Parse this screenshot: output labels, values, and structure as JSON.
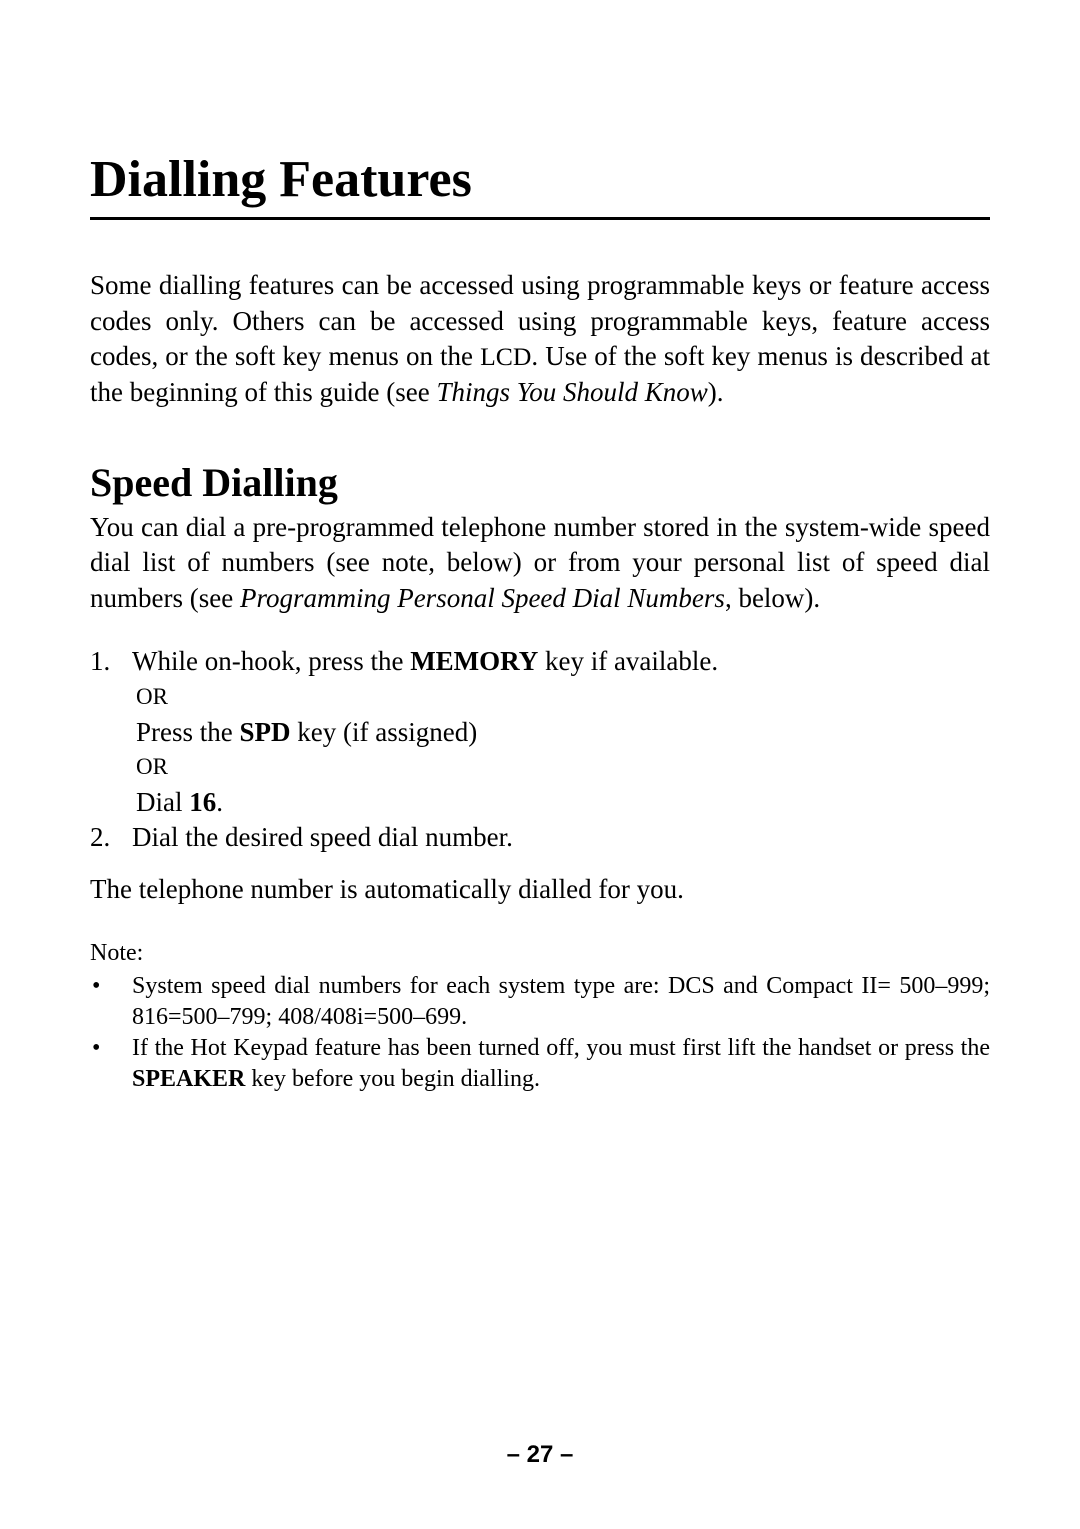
{
  "chapter_title": "Dialling Features",
  "intro": {
    "p1_a": "Some dialling features can be accessed using programmable keys or feature access codes only. Others can be accessed using programma­ble keys, feature access codes, or the soft key menus on the ",
    "p1_lcd": "LCD",
    "p1_b": ". Use of the soft key menus is described at the beginning of this guide (see ",
    "p1_italic": "Things You Should Know",
    "p1_c": ")."
  },
  "section_title": "Speed Dialling",
  "section_para": {
    "a": "You can dial a pre-programmed telephone number stored in the sys­tem-wide speed dial list of numbers (see note, below) or from your personal list of speed dial numbers (see ",
    "italic": "Programming Personal Speed Dial Numbers",
    "b": ", below)."
  },
  "steps": {
    "s1_num": "1.",
    "s1_a": "While on-hook, press the ",
    "s1_key": "MEMORY",
    "s1_b": " key if available.",
    "or1": "OR",
    "s1_line2_a": "Press the ",
    "s1_line2_key": "SPD",
    "s1_line2_b": " key (if assigned)",
    "or2": "OR",
    "s1_line3_a": "Dial ",
    "s1_line3_bold": "16",
    "s1_line3_b": ".",
    "s2_num": "2.",
    "s2_text": "Dial the desired speed dial number."
  },
  "result": "The telephone number is automatically dialled for you.",
  "note_label": "Note:",
  "notes": {
    "bullet": "•",
    "n1": "System speed dial numbers for each system type are: DCS and Compact II= 500–999; 816=500–799; 408/408i=500–699.",
    "n2_a": "If the Hot Keypad feature has been turned off, you must first lift the handset or press the ",
    "n2_key": "SPEAKER",
    "n2_b": " key before you begin dialling."
  },
  "page_number": "– 27 –"
}
